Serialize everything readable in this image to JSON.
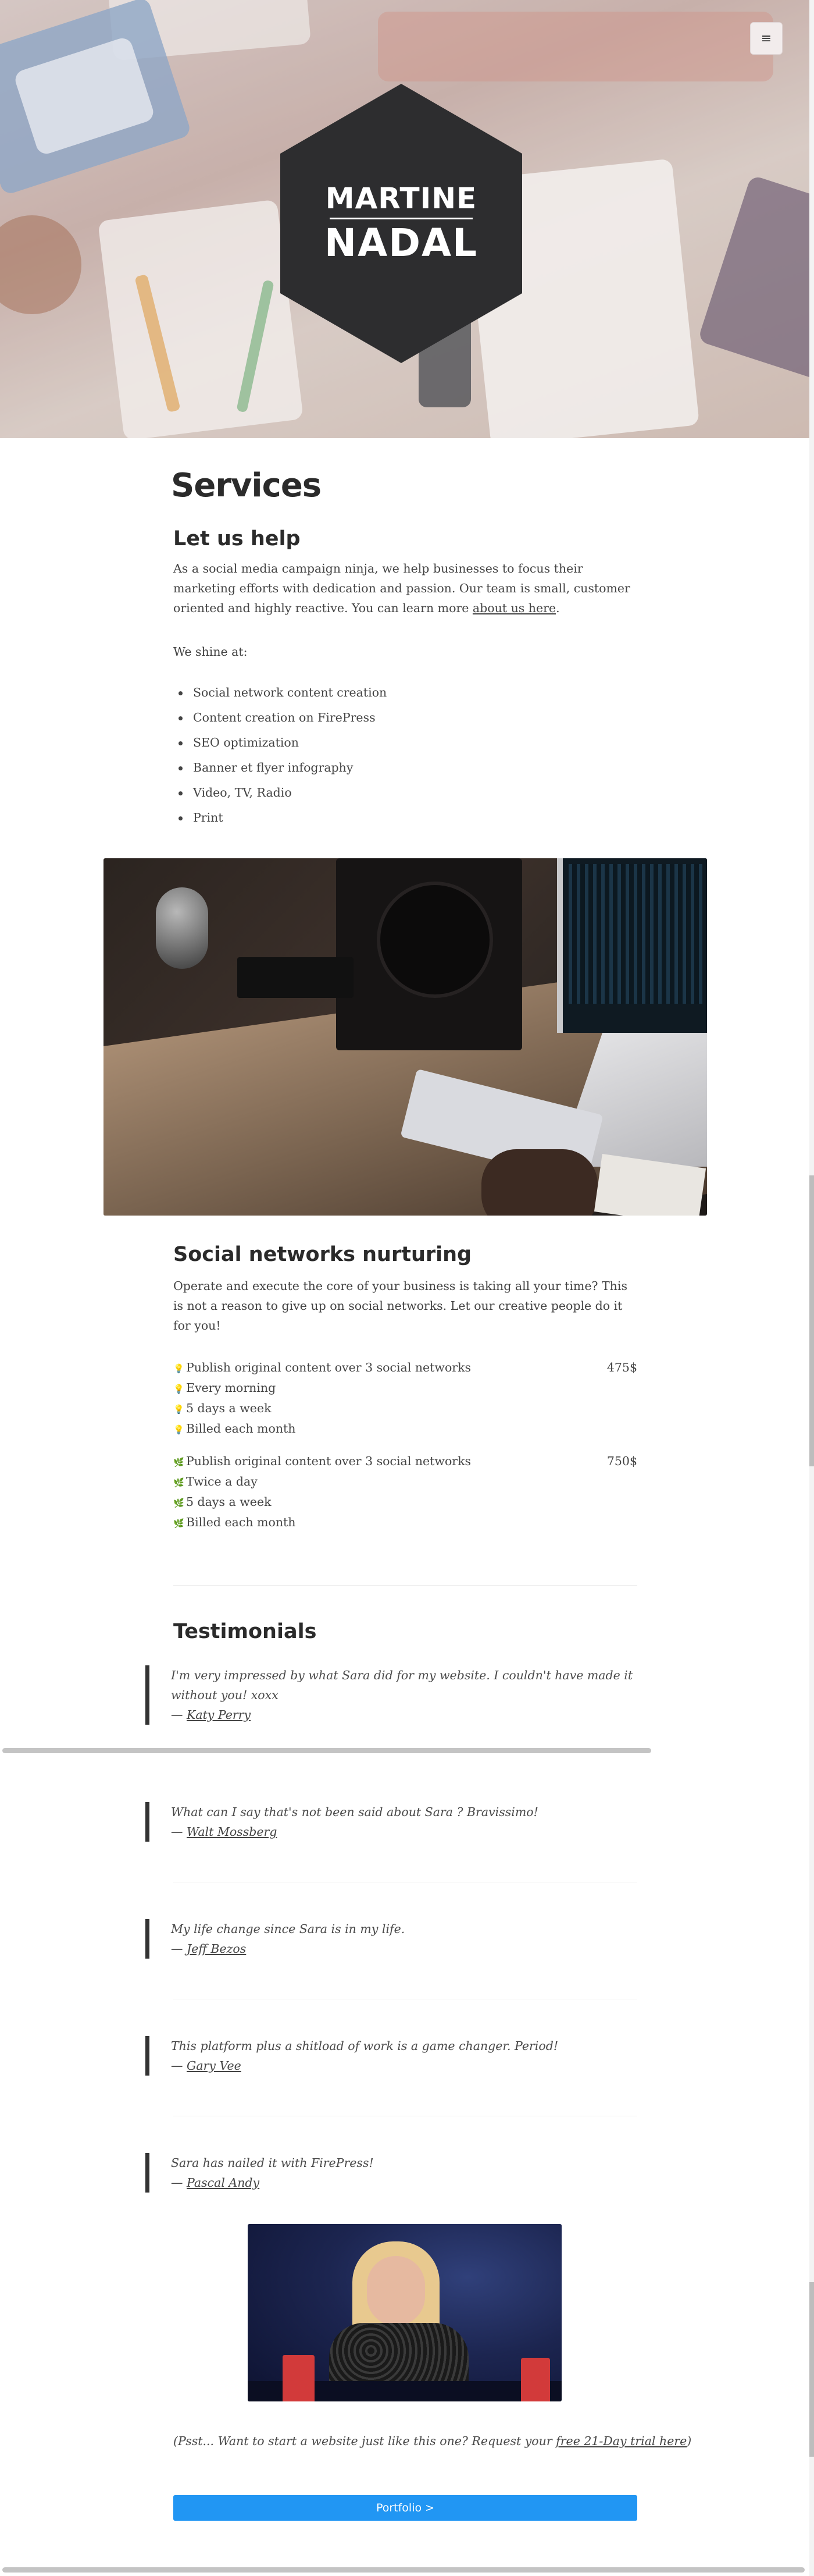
{
  "site": {
    "logo_line1": "MARTINE",
    "logo_line2": "NADAL",
    "menu_icon": "hamburger-menu-icon",
    "menu_glyph": "≡"
  },
  "services": {
    "title": "Services",
    "subtitle": "Let us help",
    "intro_before_link": "As a social media campaign ninja, we help businesses to focus their marketing efforts with dedication and passion. Our team is small, customer oriented and highly reactive. You can learn more ",
    "intro_link": "about us here",
    "intro_after_link": ".",
    "shine_label": "We shine at:",
    "shine_items": [
      "Social network content creation",
      "Content creation on FirePress",
      "SEO optimization",
      "Banner et flyer infography",
      "Video, TV, Radio",
      "Print"
    ]
  },
  "nurturing": {
    "title": "Social networks nurturing",
    "paragraph": "Operate and execute the core of your business is taking all your time? This is not a reason to give up on social networks. Let our creative people do it for you!",
    "plans": [
      {
        "icon": "lightbulb-icon",
        "glyph": "💡",
        "lines": [
          "Publish original content over 3 social networks",
          "Every morning",
          "5 days a week",
          "Billed each month"
        ],
        "price": "475$"
      },
      {
        "icon": "leaf-icon",
        "glyph": "🌿",
        "lines": [
          "Publish original content over 3 social networks",
          "Twice a day",
          "5 days a week",
          "Billed each month"
        ],
        "price": "750$"
      }
    ]
  },
  "testimonials": {
    "title": "Testimonials",
    "items": [
      {
        "text": "I'm very impressed by what Sara did for my website. I couldn't have made it without you! xoxx",
        "author": "Katy Perry"
      },
      {
        "text": "What can I say that's not been said about Sara ? Bravissimo!",
        "author": "Walt Mossberg"
      },
      {
        "text": "My life change since Sara is in my life.",
        "author": "Jeff Bezos"
      },
      {
        "text": "This platform plus a shitload of work is a game changer. Period!",
        "author": "Gary Vee"
      },
      {
        "text": "Sara has nailed it with FirePress!",
        "author": "Pascal Andy"
      }
    ],
    "dash": "— "
  },
  "footer": {
    "psst_before": "(Psst... Want to start a website just like this one? Request your ",
    "psst_link": "free 21-Day trial here",
    "psst_after": ")",
    "cta_label": "Portfolio >"
  },
  "colors": {
    "cta": "#2196f3",
    "hexagon": "#2d2d2f",
    "quote_border": "#333333"
  }
}
